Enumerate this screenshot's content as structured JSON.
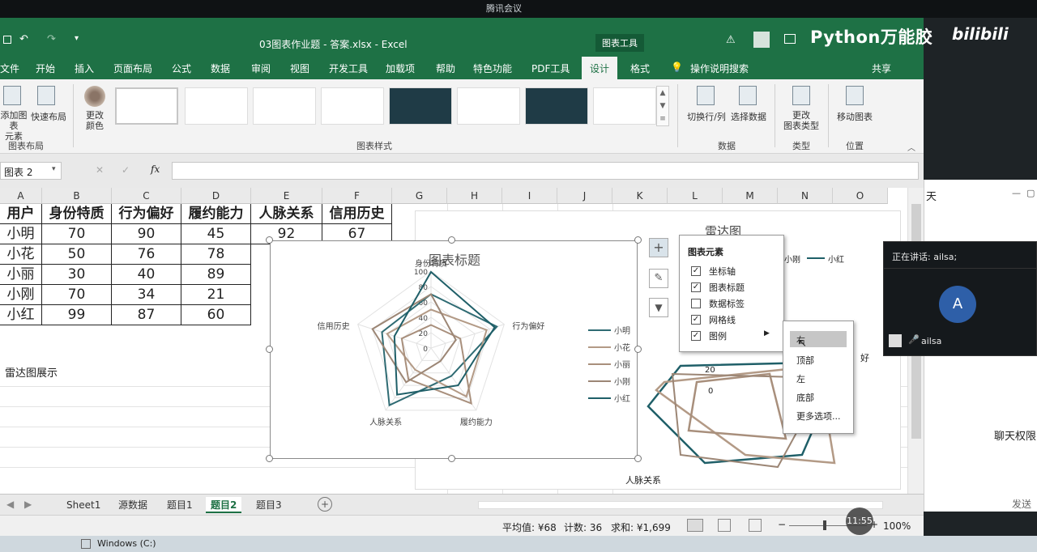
{
  "meeting_title": "腾讯会议",
  "window": {
    "title": "03图表作业题 - 答案.xlsx - Excel",
    "chart_tools": "图表工具",
    "brand": "Python万能胶",
    "bilibili": "bilibili"
  },
  "tabs": [
    "文件",
    "开始",
    "插入",
    "页面布局",
    "公式",
    "数据",
    "审阅",
    "视图",
    "开发工具",
    "加载项",
    "帮助",
    "特色功能",
    "PDF工具",
    "设计",
    "格式",
    "操作说明搜索",
    "共享"
  ],
  "ribbon": {
    "add_element": "添加图表\n元素",
    "quick_layout": "快速布局",
    "change_colors": "更改\n颜色",
    "group_layout": "图表布局",
    "group_styles": "图表样式",
    "switch_row_col": "切换行/列",
    "select_data": "选择数据",
    "group_data": "数据",
    "change_type": "更改\n图表类型",
    "group_type": "类型",
    "move_chart": "移动图表",
    "group_location": "位置"
  },
  "formula_bar": {
    "name_box": "图表 2",
    "fx": "fx",
    "value": ""
  },
  "columns": [
    "A",
    "B",
    "C",
    "D",
    "E",
    "F",
    "G",
    "H",
    "I",
    "J",
    "K",
    "L",
    "M",
    "N",
    "O"
  ],
  "table": {
    "headers": [
      "用户",
      "身份特质",
      "行为偏好",
      "履约能力",
      "人脉关系",
      "信用历史"
    ],
    "rows": [
      [
        "小明",
        "70",
        "90",
        "45",
        "92",
        "67"
      ],
      [
        "小花",
        "50",
        "76",
        "78",
        "",
        ""
      ],
      [
        "小丽",
        "30",
        "40",
        "89",
        "",
        ""
      ],
      [
        "小刚",
        "70",
        "34",
        "21",
        "",
        ""
      ],
      [
        "小红",
        "99",
        "87",
        "60",
        "",
        ""
      ]
    ]
  },
  "caption": "雷达图展示",
  "chart_data": {
    "type": "radar",
    "title": "图表标题",
    "axes": [
      "身份特质",
      "行为偏好",
      "履约能力",
      "人脉关系",
      "信用历史"
    ],
    "rlim": [
      0,
      100
    ],
    "ticks": [
      "100",
      "80",
      "60",
      "40",
      "20",
      "0"
    ],
    "legend": "right",
    "series": [
      {
        "name": "小明",
        "values": [
          70,
          90,
          45,
          92,
          67
        ],
        "color": "#2f6b73"
      },
      {
        "name": "小花",
        "values": [
          50,
          76,
          78,
          35,
          60
        ],
        "color": "#b39a86"
      },
      {
        "name": "小丽",
        "values": [
          30,
          40,
          89,
          50,
          40
        ],
        "color": "#a88f7c"
      },
      {
        "name": "小刚",
        "values": [
          70,
          34,
          21,
          55,
          80
        ],
        "color": "#9c8675"
      },
      {
        "name": "小红",
        "values": [
          99,
          87,
          60,
          75,
          50
        ],
        "color": "#1f5f68"
      }
    ]
  },
  "bg_chart": {
    "title": "雷达图",
    "label_bottom": "人脉关系",
    "legend1": "小刚",
    "legend2": "小红",
    "tick1": "20",
    "tick2": "0",
    "right_label": "好"
  },
  "chart_elements": {
    "title": "图表元素",
    "items": [
      {
        "label": "坐标轴",
        "checked": true
      },
      {
        "label": "图表标题",
        "checked": true
      },
      {
        "label": "数据标签",
        "checked": false
      },
      {
        "label": "网格线",
        "checked": true
      },
      {
        "label": "图例",
        "checked": true
      }
    ]
  },
  "legend_menu": [
    "右",
    "顶部",
    "左",
    "底部",
    "更多选项..."
  ],
  "sheet_tabs": [
    "Sheet1",
    "源数据",
    "题目1",
    "题目2",
    "题目3"
  ],
  "active_sheet": "题目2",
  "status": {
    "average": "平均值: ¥68",
    "count": "计数: 36",
    "sum": "求和: ¥1,699",
    "zoom": "100%"
  },
  "chat": {
    "title": "天",
    "speaking": "正在讲话: ailsa;",
    "avatar_letter": "A",
    "user": "ailsa",
    "perm": "聊天权限",
    "send": "发送"
  },
  "time": "11:55",
  "taskbar": {
    "drive": "Windows (C:)"
  }
}
